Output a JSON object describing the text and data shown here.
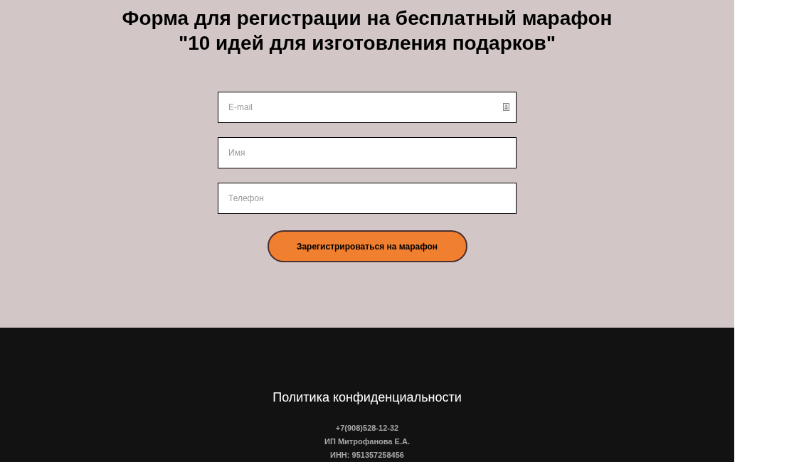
{
  "title": {
    "lines": [
      "Форма для регистрации на бесплатный марафон",
      "\"10 идей для изготовления подарков\""
    ]
  },
  "form": {
    "fields": [
      {
        "placeholder": "E-mail",
        "kind": "email"
      },
      {
        "placeholder": "Имя",
        "kind": "text"
      },
      {
        "placeholder": "Телефон",
        "kind": "text"
      }
    ],
    "submit": "Зарегистрироваться на марафон"
  },
  "footer": {
    "policy_link": "Политика конфиденциальности",
    "contacts": [
      "+7(908)528-12-32",
      "ИП Митрофанова Е.А.",
      "ИНН: 951357258456"
    ]
  }
}
